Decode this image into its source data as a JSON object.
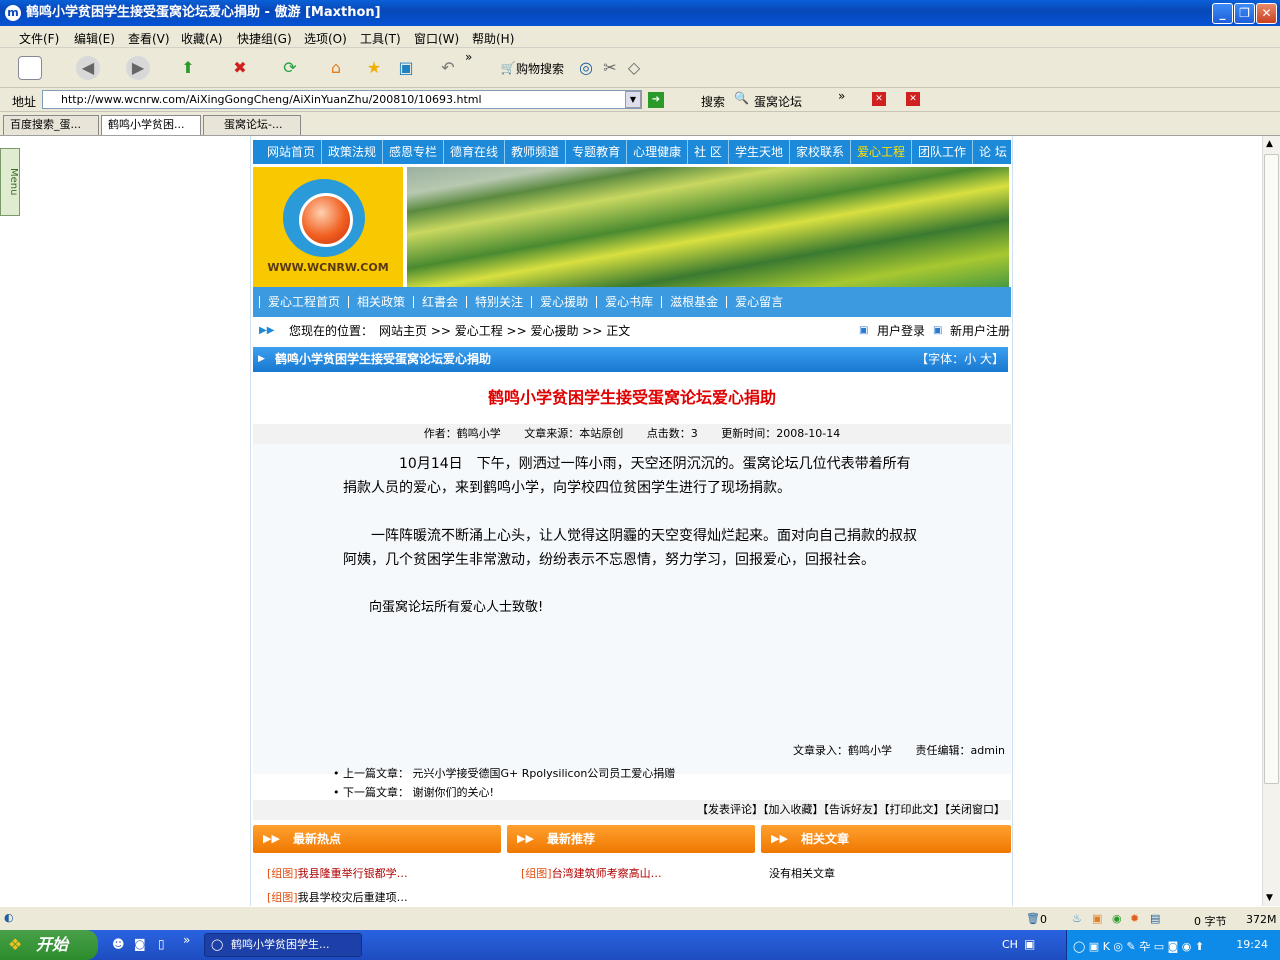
{
  "window": {
    "title": "鹤鸣小学贫困学生接受蛋窝论坛爱心捐助 - 傲游 [Maxthon]",
    "app_icon": "maxthon-icon"
  },
  "menubar": [
    "文件(F)",
    "编辑(E)",
    "查看(V)",
    "收藏(A)",
    "快捷组(G)",
    "选项(O)",
    "工具(T)",
    "窗口(W)",
    "帮助(H)"
  ],
  "toolbar": {
    "shopping_label": "购物搜索",
    "more": "»"
  },
  "address": {
    "label": "地址",
    "url": "http://www.wcnrw.com/AiXingGongCheng/AiXinYuanZhu/200810/10693.html",
    "search_label": "搜索",
    "search_engine": "蛋窝论坛"
  },
  "tabs": [
    "百度搜索_蛋...",
    "鹤鸣小学贫困...",
    "蛋窝论坛-..."
  ],
  "sidebar_menu": "Menu",
  "site": {
    "top_nav": [
      "网站首页",
      "政策法规",
      "感恩专栏",
      "德育在线",
      "教师频道",
      "专题教育",
      "心理健康",
      "社 区",
      "学生天地",
      "家校联系",
      "爱心工程",
      "团队工作",
      "论 坛"
    ],
    "logo_text": "WWW.WCNRW.COM",
    "sub_nav": [
      "爱心工程首页",
      "相关政策",
      "红書会",
      "特别关注",
      "爱心援助",
      "爱心书库",
      "滋根基金",
      "爱心留言"
    ],
    "breadcrumb": {
      "prefix": "您现在的位置：",
      "path": "网站主页 >> 爱心工程 >> 爱心援助 >> 正文",
      "login": "用户登录",
      "register": "新用户注册"
    },
    "title_bar": "鹤鸣小学贫困学生接受蛋窝论坛爱心捐助",
    "font_size": "【字体：小 大】",
    "article": {
      "title": "鹤鸣小学贫困学生接受蛋窝论坛爱心捐助",
      "author": "作者：鹤鸣小学",
      "source": "文章来源：本站原创",
      "hits": "点击数：3",
      "updated": "更新时间：2008-10-14",
      "p1": "　　　　10月14日　下午，刚洒过一阵小雨，天空还阴沉沉的。蛋窝论坛几位代表带着所有捐款人员的爱心，来到鹤鸣小学，向学校四位贫困学生进行了现场捐款。",
      "p2": "　　一阵阵暖流不断涌上心头，让人觉得这阴霾的天空变得灿烂起来。面对向自己捐款的叔叔阿姨，几个贫困学生非常激动，纷纷表示不忘恩情，努力学习，回报爱心，回报社会。",
      "p3": "　　向蛋窝论坛所有爱心人士致敬!",
      "entered_by": "文章录入：鹤鸣小学",
      "editor": "责任编辑：admin",
      "prev": "上一篇文章：  元兴小学接受德国G+ Rpolysilicon公司员工爱心捐赠",
      "next": "下一篇文章：  谢谢你们的关心!",
      "actions": "【发表评论】【加入收藏】【告诉好友】【打印此文】【关闭窗口】"
    },
    "sections": [
      {
        "title": "最新热点",
        "links": [
          {
            "tag": "[组图]",
            "text": "我县隆重举行银都学…"
          },
          {
            "tag": "[组图]",
            "text": "我县学校灾后重建项…"
          }
        ]
      },
      {
        "title": "最新推荐",
        "links": [
          {
            "tag": "[组图]",
            "text": "台湾建筑师考察高山…"
          }
        ]
      },
      {
        "title": "相关文章",
        "links": [
          {
            "tag": "",
            "text": "没有相关文章"
          }
        ]
      }
    ]
  },
  "statusbar": {
    "trash_count": "0",
    "bytes": "0 字节",
    "memory": "372M"
  },
  "taskbar": {
    "start": "开始",
    "task": "鹤鸣小学贫困学生...",
    "lang": "CH",
    "clock": "19:24"
  }
}
